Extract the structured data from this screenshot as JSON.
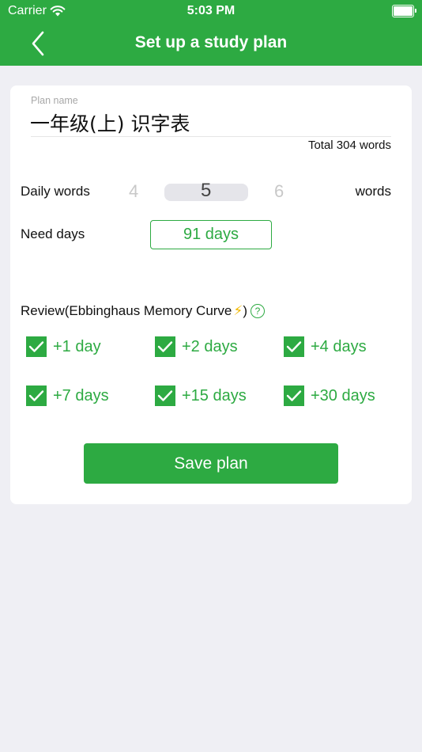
{
  "status_bar": {
    "carrier": "Carrier",
    "time": "5:03 PM"
  },
  "nav": {
    "title": "Set up a study plan"
  },
  "plan": {
    "label": "Plan name",
    "name": "一年级(上) 识字表",
    "total": "Total 304 words"
  },
  "daily": {
    "label": "Daily words",
    "picker_values": [
      "4",
      "5",
      "6"
    ],
    "selected": "5",
    "unit": "words"
  },
  "need_days": {
    "label": "Need days",
    "value": "91 days"
  },
  "review": {
    "title": "Review(Ebbinghaus Memory Curve",
    "bolt": "⚡",
    "title_suffix": ")",
    "help": "?",
    "items": [
      {
        "label": "+1 day",
        "checked": true
      },
      {
        "label": "+2 days",
        "checked": true
      },
      {
        "label": "+4 days",
        "checked": true
      },
      {
        "label": "+7 days",
        "checked": true
      },
      {
        "label": "+15 days",
        "checked": true
      },
      {
        "label": "+30 days",
        "checked": true
      }
    ]
  },
  "save_button": {
    "label": "Save plan"
  },
  "colors": {
    "accent": "#2daa42",
    "background": "#efeff4",
    "bolt": "#f2b900"
  }
}
